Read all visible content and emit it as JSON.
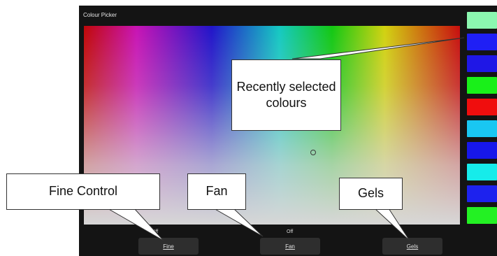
{
  "window": {
    "title": "Colour Picker"
  },
  "swatches": [
    {
      "color": "#8cf7b0"
    },
    {
      "color": "#1f1ff5"
    },
    {
      "color": "#1f17e6"
    },
    {
      "color": "#19f019"
    },
    {
      "color": "#f00d0d"
    },
    {
      "color": "#19c7f2"
    },
    {
      "color": "#1717ea"
    },
    {
      "color": "#16ecea"
    },
    {
      "color": "#1d22ee"
    },
    {
      "color": "#23f123"
    }
  ],
  "softkeys": {
    "fine": {
      "status": "Off",
      "label": "Fine"
    },
    "fan": {
      "status": "Off",
      "label": "Fan"
    },
    "gels": {
      "label": "Gels"
    }
  },
  "callouts": {
    "recent": "Recently selected colours",
    "fine": "Fine Control",
    "fan": "Fan",
    "gels": "Gels"
  }
}
